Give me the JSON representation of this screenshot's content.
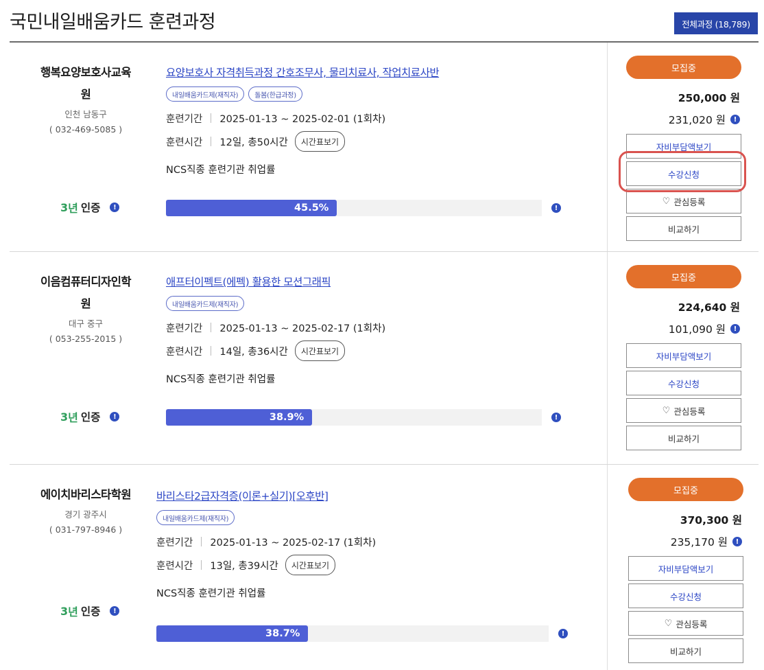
{
  "header": {
    "title": "국민내일배움카드 훈련과정",
    "total_button": "전체과정 (18,789)"
  },
  "labels": {
    "period": "훈련기간",
    "hours": "훈련시간",
    "timetable_button": "시간표보기",
    "ncs": "NCS직종 훈련기관 취업률",
    "cert_3": "3",
    "cert_year": "년",
    "cert_text": "인증",
    "info": "!",
    "status": "모집중",
    "self_pay_button": "자비부담액보기",
    "apply_button": "수강신청",
    "favorite_button": "관심등록",
    "compare_button": "비교하기",
    "heart_icon": "♡"
  },
  "courses": [
    {
      "institution_line1": "행복요양보호사교육",
      "institution_line2": "원",
      "location": "인천 남동구",
      "phone": "( 032-469-5085 )",
      "title": "요양보호사 자격취득과정 간호조무사, 물리치료사, 작업치료사반",
      "tags": [
        "내일배움카드제(재직자)",
        "돌봄(한급과정)"
      ],
      "period": "2025-01-13 ~ 2025-02-01 (1회차)",
      "hours": "12일, 총50시간",
      "employment_rate": 45.5,
      "employment_rate_label": "45.5%",
      "price": "250,000 원",
      "self_pay": "231,020 원"
    },
    {
      "institution_line1": "이음컴퓨터디자인학",
      "institution_line2": "원",
      "location": "대구 중구",
      "phone": "( 053-255-2015 )",
      "title": "애프터이펙트(에펙) 활용한 모션그래픽",
      "tags": [
        "내일배움카드제(재직자)"
      ],
      "period": "2025-01-13 ~ 2025-02-17 (1회차)",
      "hours": "14일, 총36시간",
      "employment_rate": 38.9,
      "employment_rate_label": "38.9%",
      "price": "224,640 원",
      "self_pay": "101,090 원"
    },
    {
      "institution_line1": "에이치바리스타학원",
      "institution_line2": "",
      "location": "경기 광주시",
      "phone": "( 031-797-8946 )",
      "title": "바리스타2급자격증(이론+실기)[오후반]",
      "tags": [
        "내일배움카드제(재직자)"
      ],
      "period": "2025-01-13 ~ 2025-02-17 (1회차)",
      "hours": "13일, 총39시간",
      "employment_rate": 38.7,
      "employment_rate_label": "38.7%",
      "price": "370,300 원",
      "self_pay": "235,170 원"
    }
  ],
  "colors": {
    "accent_blue": "#2c46c5",
    "status_orange": "#e3702b",
    "bar_fill": "#4e5fd6",
    "highlight_red": "#d9534f"
  }
}
